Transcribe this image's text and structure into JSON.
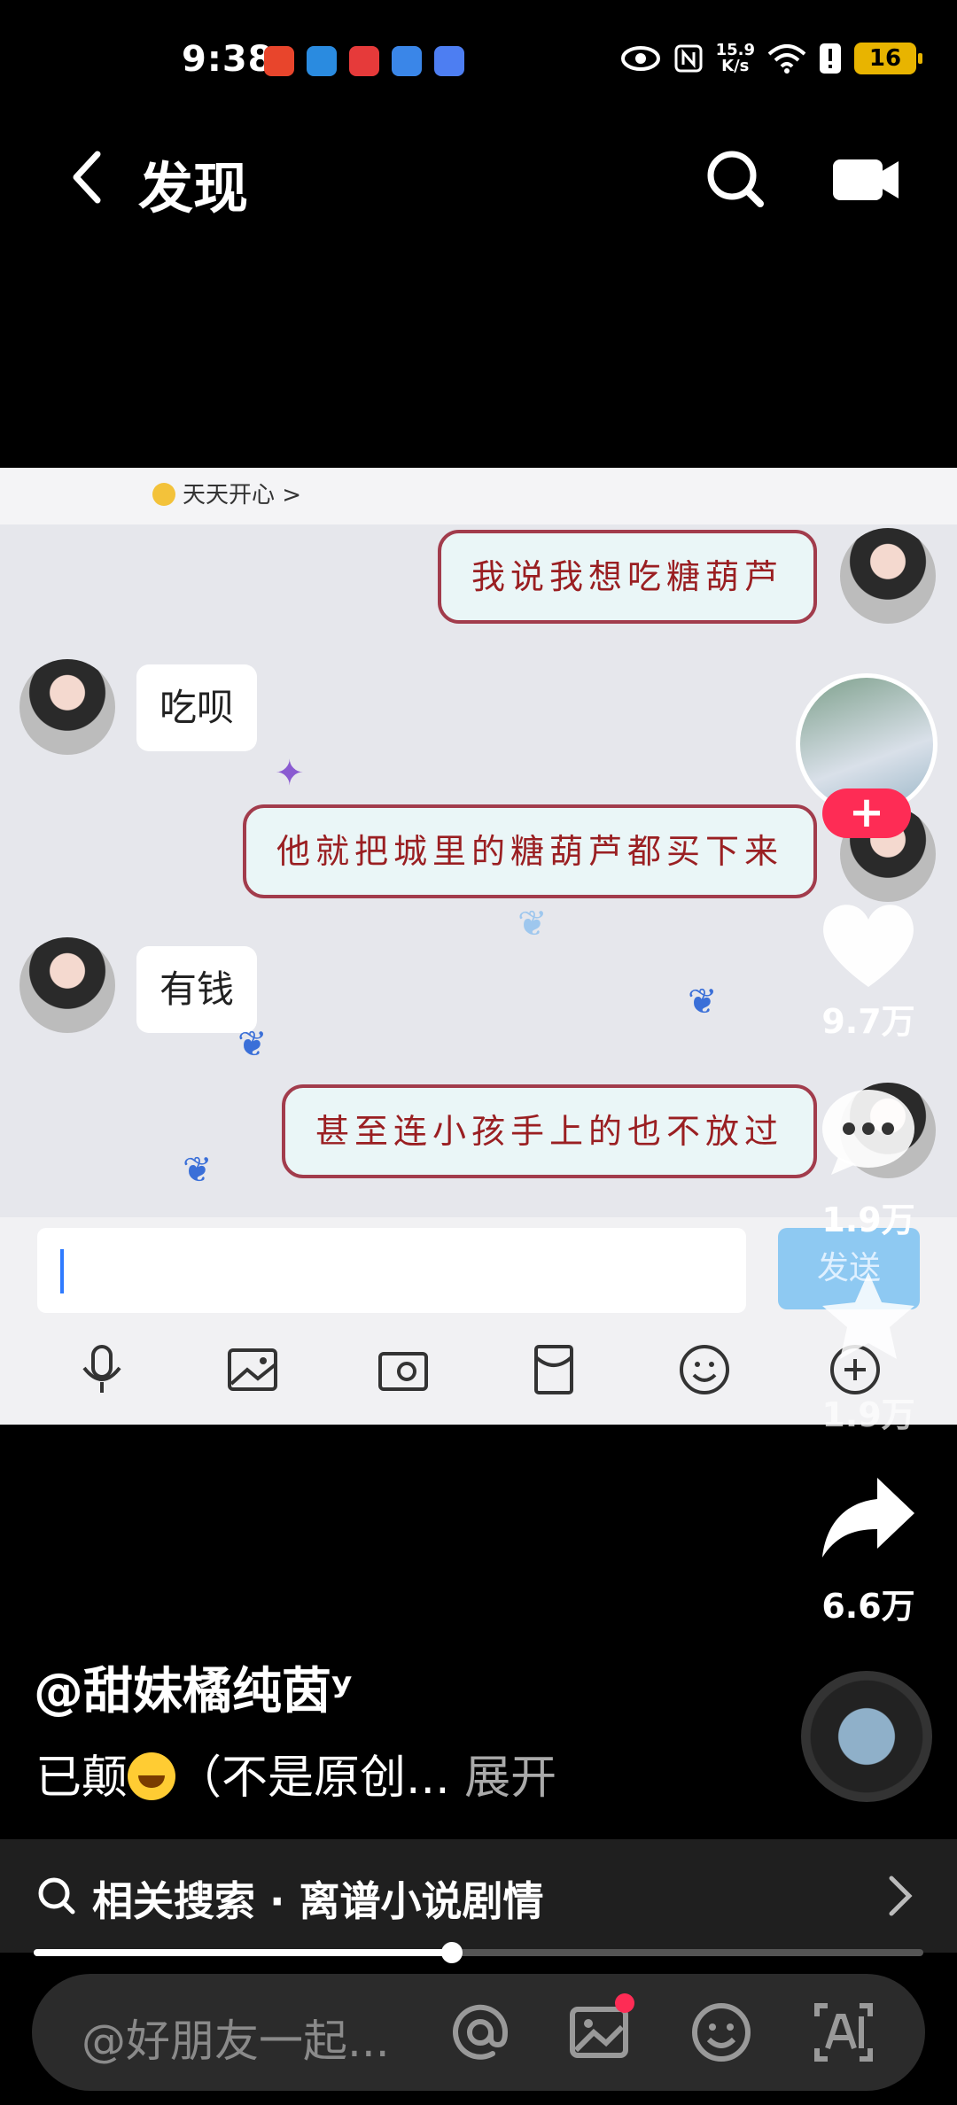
{
  "status_bar": {
    "time": "9:38",
    "net_speed_value": "15.9",
    "net_speed_unit": "K/s",
    "battery": "16"
  },
  "header": {
    "title": "发现"
  },
  "video": {
    "chat_status": "天天开心 >",
    "messages": [
      {
        "side": "right",
        "text": "我说我想吃糖葫芦"
      },
      {
        "side": "left",
        "text": "吃呗"
      },
      {
        "side": "right",
        "text": "他就把城里的糖葫芦都买下来"
      },
      {
        "side": "left",
        "text": "有钱"
      },
      {
        "side": "right",
        "text": "甚至连小孩手上的也不放过"
      }
    ],
    "send_label": "发送"
  },
  "actions": {
    "follow": "+",
    "likes": "9.7万",
    "comments": "1.9万",
    "favorites": "1.9万",
    "shares": "6.6万"
  },
  "caption": {
    "author": "@甜妹橘纯茵ʸ",
    "text_before": "已颠",
    "text_after": "（不是原创... ",
    "expand": "展开"
  },
  "related": {
    "text": "相关搜索 · 离谱小说剧情"
  },
  "progress": {
    "fraction": 0.47
  },
  "comment_bar": {
    "placeholder": "@好朋友一起..."
  },
  "colors": {
    "accent": "#fe2c55",
    "bubble_border": "#a23c4c",
    "bubble_text": "#9a1f22",
    "send_button": "#8ec9f2"
  }
}
